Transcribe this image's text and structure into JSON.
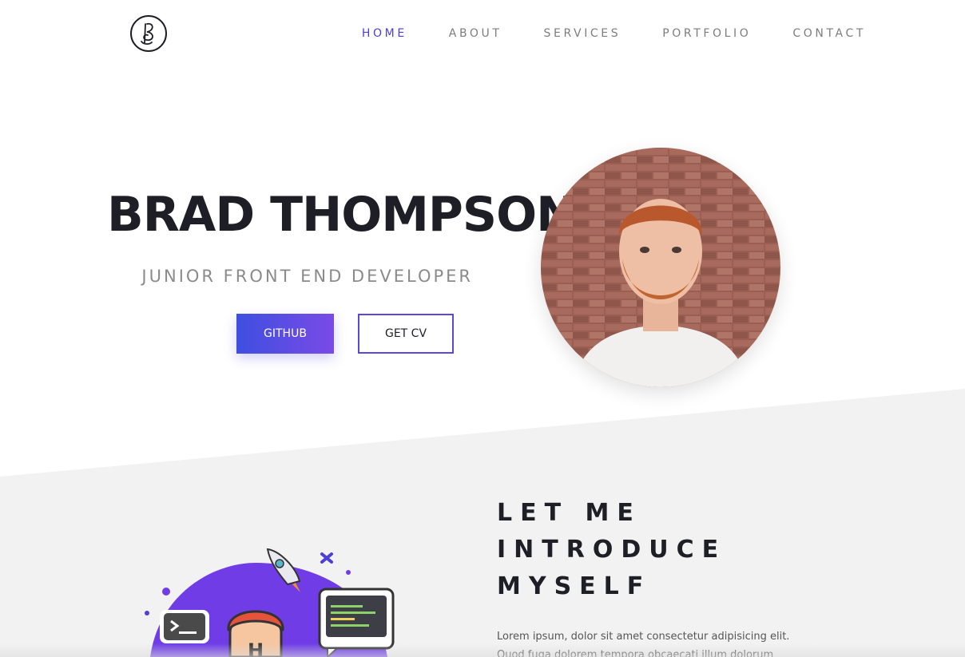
{
  "nav": {
    "items": [
      {
        "label": "HOME",
        "active": true
      },
      {
        "label": "ABOUT",
        "active": false
      },
      {
        "label": "SERVICES",
        "active": false
      },
      {
        "label": "PORTFOLIO",
        "active": false
      },
      {
        "label": "CONTACT",
        "active": false
      }
    ]
  },
  "hero": {
    "name": "BRAD THOMPSON",
    "subtitle": "JUNIOR FRONT END DEVELOPER",
    "github_label": "GITHUB",
    "cv_label": "GET CV"
  },
  "intro": {
    "title_lines": [
      "LET ME",
      "INTRODUCE",
      "MYSELF"
    ],
    "text": "Lorem ipsum, dolor sit amet consectetur adipisicing elit. Quod fuga dolorem tempora obcaecati illum dolorum eveniet, beatae impedit"
  },
  "colors": {
    "accent": "#4b3fd6",
    "accent_gradient_end": "#7a4ae6",
    "section_bg": "#f2f2f2",
    "illustration_circle": "#6f3ce6"
  }
}
